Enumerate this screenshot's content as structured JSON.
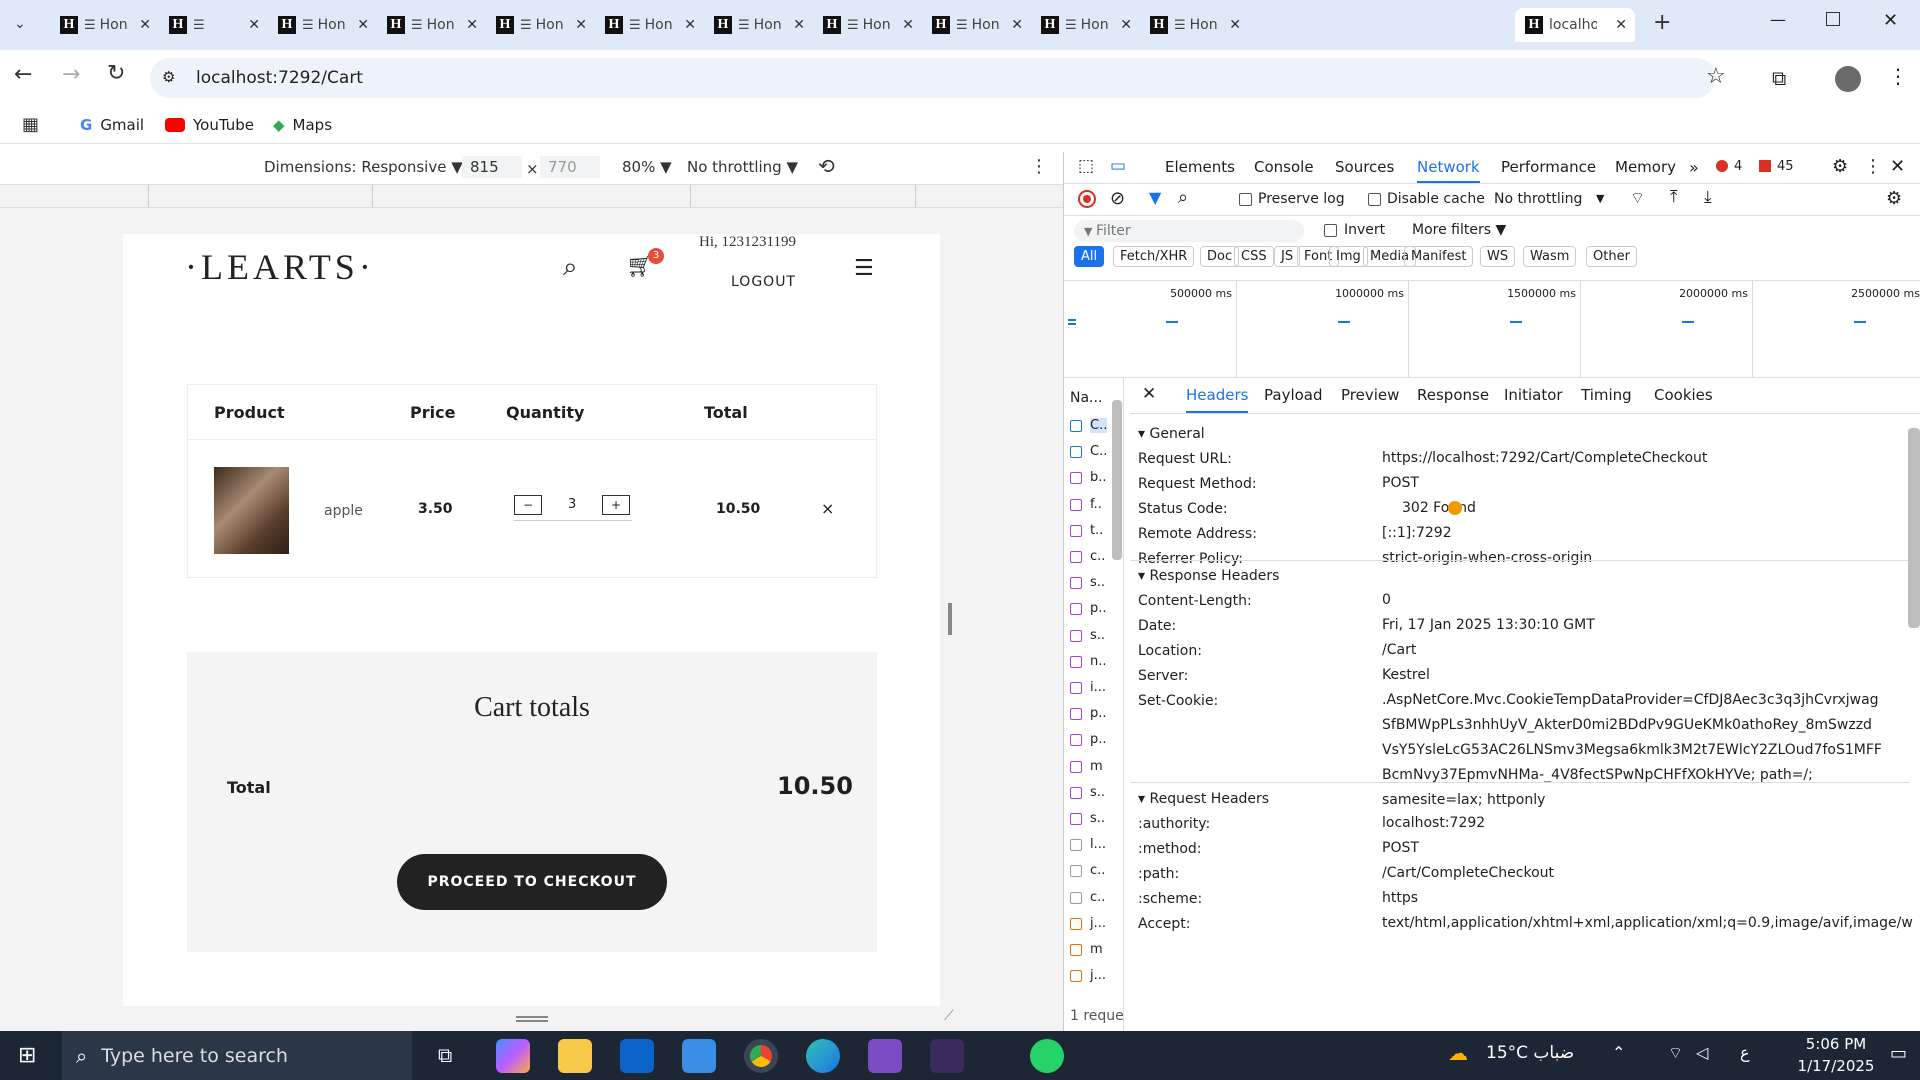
{
  "tabs": [
    {
      "title": "Hon"
    },
    {
      "title": ""
    },
    {
      "title": "Hon"
    },
    {
      "title": "Hon"
    },
    {
      "title": "Hon"
    },
    {
      "title": "Hon"
    },
    {
      "title": "Hon"
    },
    {
      "title": "Hon"
    },
    {
      "title": "Hon"
    },
    {
      "title": "Hon"
    },
    {
      "title": "Hon"
    }
  ],
  "active_tab": {
    "title": "localhost"
  },
  "address": {
    "url": "localhost:7292/Cart"
  },
  "bookmarks": [
    {
      "label": "Gmail"
    },
    {
      "label": "YouTube"
    },
    {
      "label": "Maps"
    }
  ],
  "device_toolbar": {
    "dimensions": "Dimensions: Responsive ▼",
    "width": "815",
    "x": "×",
    "height": "770",
    "zoom": "80% ▼",
    "throttle": "No throttling ▼"
  },
  "site": {
    "logo": "·LEARTS·",
    "greeting": "Hi, 1231231199",
    "logout": "LOGOUT",
    "cart_count": "3",
    "table_headers": {
      "product": "Product",
      "price": "Price",
      "quantity": "Quantity",
      "total": "Total"
    },
    "item": {
      "name": "apple",
      "price": "3.50",
      "qty": "3",
      "total": "10.50",
      "remove": "×"
    },
    "totals_title": "Cart totals",
    "total_label": "Total",
    "total_value": "10.50",
    "checkout": "PROCEED TO CHECKOUT"
  },
  "devtools": {
    "tabs": [
      "Elements",
      "Console",
      "Sources",
      "Network",
      "Performance",
      "Memory"
    ],
    "active_tab": "Network",
    "errors": "4",
    "warnings": "45",
    "preserve_log": "Preserve log",
    "disable_cache": "Disable cache",
    "throttling": "No throttling",
    "filter_placeholder": "Filter",
    "invert": "Invert",
    "more_filters": "More filters ▼",
    "type_filters": [
      "All",
      "Fetch/XHR",
      "Doc",
      "CSS",
      "JS",
      "Font",
      "Img",
      "Media",
      "Manifest",
      "WS",
      "Wasm",
      "Other"
    ],
    "timeline": [
      "500000 ms",
      "1000000 ms",
      "1500000 ms",
      "2000000 ms",
      "2500000 ms"
    ],
    "name_col": "Na...",
    "requests": [
      "C..",
      "C..",
      "b..",
      "f..",
      "t..",
      "c..",
      "s..",
      "p..",
      "s..",
      "n..",
      "i...",
      "p..",
      "p..",
      "m",
      "s..",
      "s..",
      "l...",
      "c..",
      "c..",
      "j...",
      "m",
      "j..."
    ],
    "request_count": "1 reque",
    "detail_tabs": [
      "Headers",
      "Payload",
      "Preview",
      "Response",
      "Initiator",
      "Timing",
      "Cookies"
    ],
    "general_title": "General",
    "general": [
      {
        "k": "Request URL:",
        "v": "https://localhost:7292/Cart/CompleteCheckout"
      },
      {
        "k": "Request Method:",
        "v": "POST"
      },
      {
        "k": "Status Code:",
        "v": "302 Found"
      },
      {
        "k": "Remote Address:",
        "v": "[::1]:7292"
      },
      {
        "k": "Referrer Policy:",
        "v": "strict-origin-when-cross-origin"
      }
    ],
    "response_title": "Response Headers",
    "response": [
      {
        "k": "Content-Length:",
        "v": "0"
      },
      {
        "k": "Date:",
        "v": "Fri, 17 Jan 2025 13:30:10 GMT"
      },
      {
        "k": "Location:",
        "v": "/Cart"
      },
      {
        "k": "Server:",
        "v": "Kestrel"
      },
      {
        "k": "Set-Cookie:",
        "v": ".AspNetCore.Mvc.CookieTempDataProvider=CfDJ8Aec3c3q3jhCvrxjwag SfBMWpPLs3nhhUyV_AkterD0mi2BDdPv9GUeKMk0athoRey_8mSwzzd VsY5YsleLcG53AC26LNSmv3Megsa6kmlk3M2t7EWlcY2ZLOud7foS1MFF BcmNvy37EpmvNHMa-_4V8fectSPwNpCHFfXOkHYVe; path=/; samesite=lax; httponly"
      }
    ],
    "request_title": "Request Headers",
    "request": [
      {
        "k": ":authority:",
        "v": "localhost:7292"
      },
      {
        "k": ":method:",
        "v": "POST"
      },
      {
        "k": ":path:",
        "v": "/Cart/CompleteCheckout"
      },
      {
        "k": ":scheme:",
        "v": "https"
      },
      {
        "k": "Accept:",
        "v": "text/html,application/xhtml+xml,application/xml;q=0.9,image/avif,image/w"
      }
    ]
  },
  "taskbar": {
    "search": "Type here to search",
    "weather": "15°C ضباب",
    "lang": "ع",
    "time": "5:06 PM",
    "date": "1/17/2025"
  },
  "colors": {
    "accent": "#1a73e8",
    "status_dot": "#f29900",
    "button": "#222222",
    "error": "#d93025"
  }
}
